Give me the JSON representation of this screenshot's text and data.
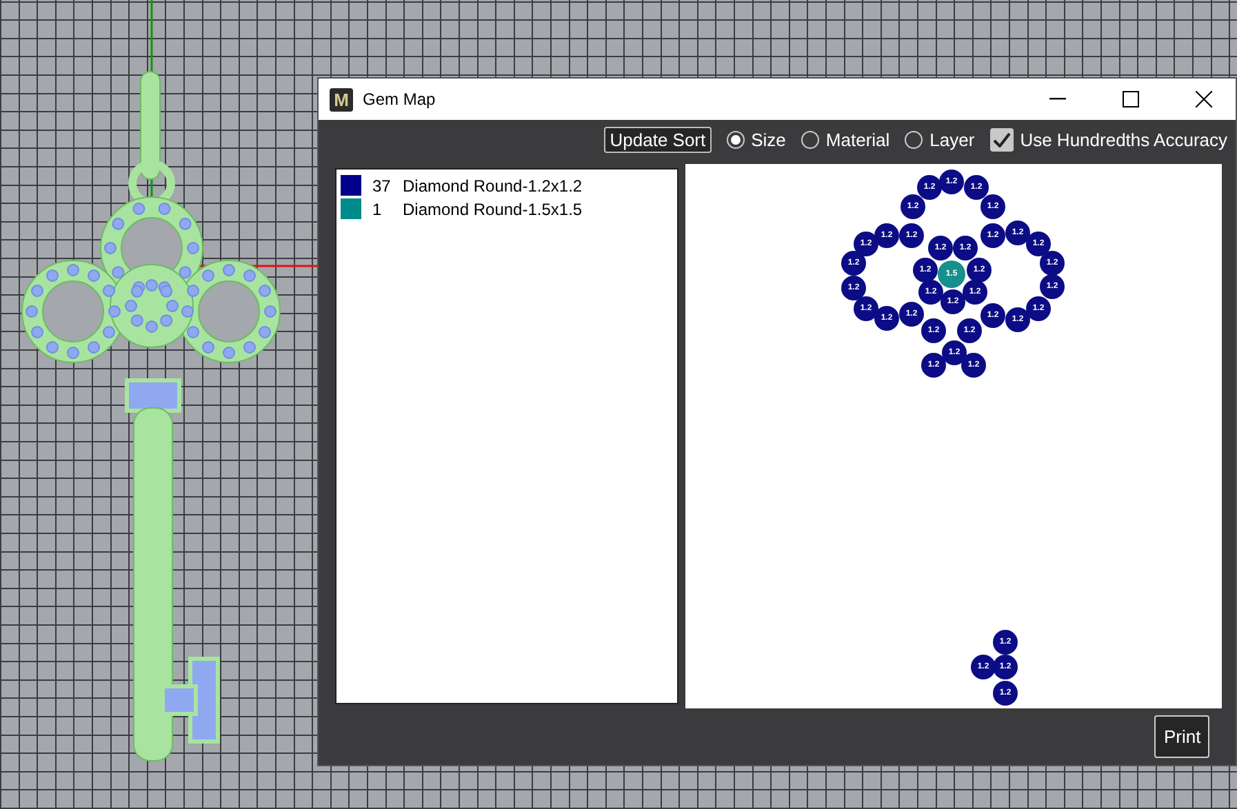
{
  "window": {
    "icon_letter": "M",
    "title": "Gem Map"
  },
  "toolbar": {
    "update_button": "Update Sort",
    "sort_options": [
      {
        "label": "Size",
        "selected": true
      },
      {
        "label": "Material",
        "selected": false
      },
      {
        "label": "Layer",
        "selected": false
      }
    ],
    "accuracy": {
      "label": "Use Hundredths Accuracy",
      "checked": true
    }
  },
  "legend": [
    {
      "count": "37",
      "name": "Diamond Round-1.2x1.2",
      "color": "#00008b"
    },
    {
      "count": "1",
      "name": "Diamond Round-1.5x1.5",
      "color": "#008b8b"
    }
  ],
  "gem_map": {
    "gems": [
      {
        "label": "1.2",
        "color": "#0c0c86"
      },
      {
        "label": "1.2",
        "color": "#0c0c86"
      },
      {
        "label": "1.2",
        "color": "#0c0c86"
      },
      {
        "label": "1.2",
        "color": "#0c0c86"
      },
      {
        "label": "1.2",
        "color": "#0c0c86"
      },
      {
        "label": "1.2",
        "color": "#0c0c86"
      },
      {
        "label": "1.2",
        "color": "#0c0c86"
      },
      {
        "label": "1.2",
        "color": "#0c0c86"
      },
      {
        "label": "1.2",
        "color": "#0c0c86"
      },
      {
        "label": "1.2",
        "color": "#0c0c86"
      },
      {
        "label": "1.2",
        "color": "#0c0c86"
      },
      {
        "label": "1.2",
        "color": "#0c0c86"
      },
      {
        "label": "1.2",
        "color": "#0c0c86"
      },
      {
        "label": "1.2",
        "color": "#0c0c86"
      },
      {
        "label": "1.2",
        "color": "#0c0c86"
      },
      {
        "label": "1.2",
        "color": "#0c0c86"
      },
      {
        "label": "1.2",
        "color": "#0c0c86"
      },
      {
        "label": "1.2",
        "color": "#0c0c86"
      },
      {
        "label": "1.2",
        "color": "#0c0c86"
      },
      {
        "label": "1.2",
        "color": "#0c0c86"
      },
      {
        "label": "1.2",
        "color": "#0c0c86"
      },
      {
        "label": "1.2",
        "color": "#0c0c86"
      },
      {
        "label": "1.2",
        "color": "#0c0c86"
      },
      {
        "label": "1.2",
        "color": "#0c0c86"
      },
      {
        "label": "1.2",
        "color": "#0c0c86"
      },
      {
        "label": "1.5",
        "color": "#16908c"
      },
      {
        "label": "1.2",
        "color": "#0c0c86"
      },
      {
        "label": "1.2",
        "color": "#0c0c86"
      },
      {
        "label": "1.2",
        "color": "#0c0c86"
      },
      {
        "label": "1.2",
        "color": "#0c0c86"
      },
      {
        "label": "1.2",
        "color": "#0c0c86"
      },
      {
        "label": "1.2",
        "color": "#0c0c86"
      },
      {
        "label": "1.2",
        "color": "#0c0c86"
      },
      {
        "label": "1.2",
        "color": "#0c0c86"
      },
      {
        "label": "1.2",
        "color": "#0c0c86"
      },
      {
        "label": "1.2",
        "color": "#0c0c86"
      },
      {
        "label": "1.2",
        "color": "#0c0c86"
      },
      {
        "label": "1.2",
        "color": "#0c0c86"
      }
    ]
  },
  "print_button": "Print"
}
